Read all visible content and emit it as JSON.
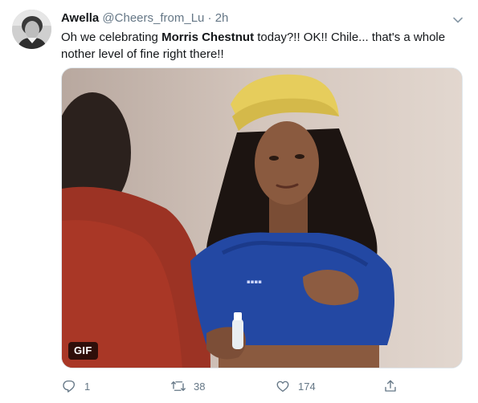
{
  "author": {
    "name": "Awella",
    "handle": "@Cheers_from_Lu",
    "separator": "·",
    "time": "2h"
  },
  "tweet": {
    "text_start": "Oh we celebrating ",
    "text_bold": "Morris Chestnut",
    "text_end": " today?!! OK!! Chile... that's a whole nother level of fine right there!!"
  },
  "media": {
    "badge": "GIF"
  },
  "actions": {
    "reply_count": "1",
    "retweet_count": "38",
    "like_count": "174"
  },
  "icons": {
    "caret": "chevron-down-icon",
    "reply": "reply-icon",
    "retweet": "retweet-icon",
    "like": "heart-icon",
    "share": "share-icon"
  },
  "colors": {
    "text": "#14171a",
    "secondary": "#657786",
    "border": "#e1e8ed"
  }
}
